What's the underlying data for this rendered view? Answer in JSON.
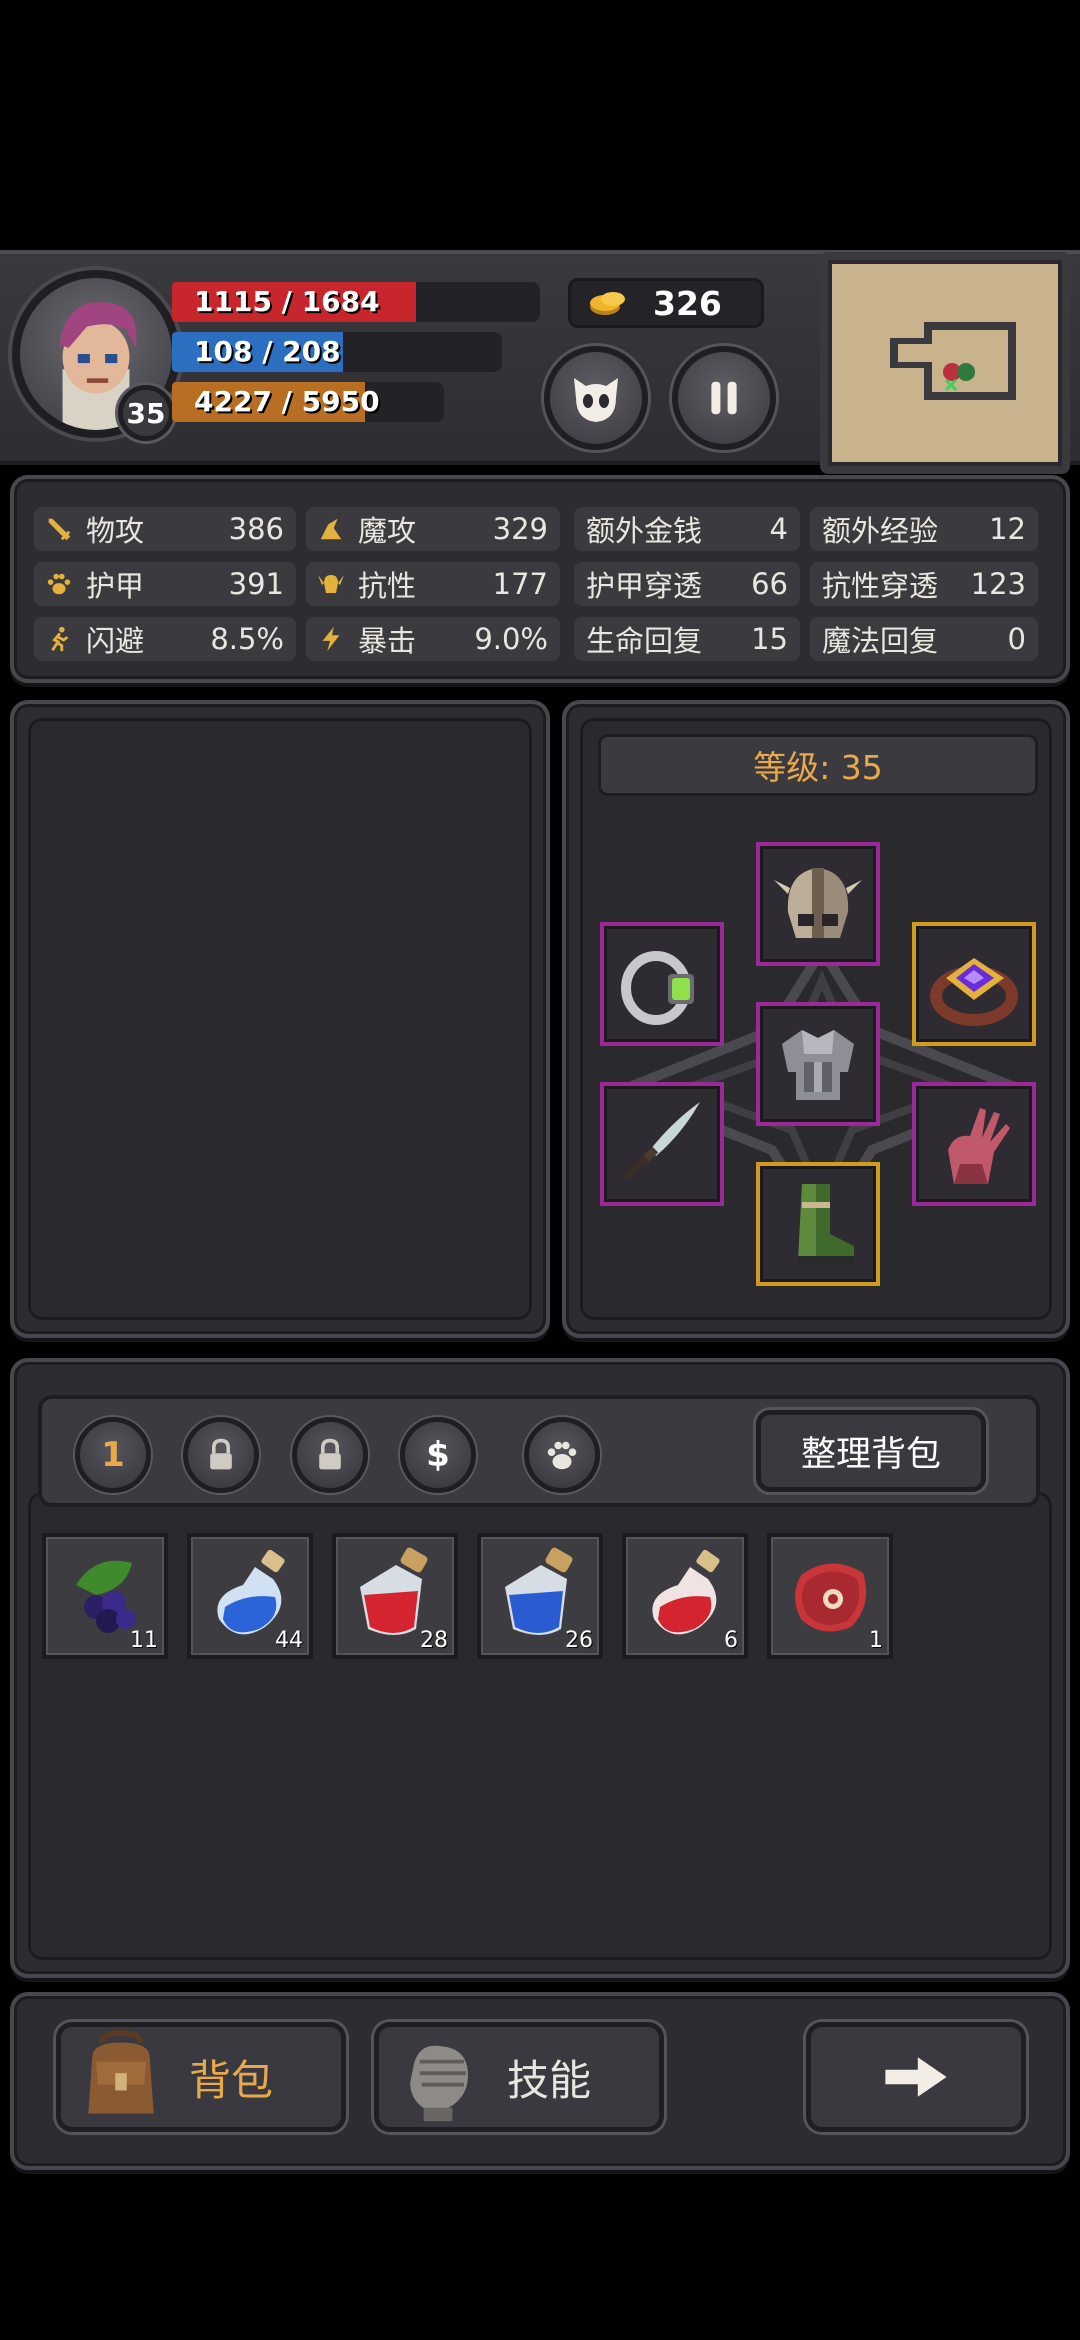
{
  "hud": {
    "hp": {
      "current": 1115,
      "max": 1684,
      "text": "1115 / 1684",
      "color": "#c6262c"
    },
    "mp": {
      "current": 108,
      "max": 208,
      "text": "108 / 208",
      "color": "#2c6fc1"
    },
    "xp": {
      "current": 4227,
      "max": 5950,
      "text": "4227 / 5950",
      "color": "#b86f23"
    },
    "level": "35",
    "gold": "326",
    "icons": {
      "portrait": "hero-portrait",
      "coin": "coin-icon",
      "character": "character-face-icon",
      "pause": "pause-icon",
      "minimap": "minimap"
    }
  },
  "stats": [
    {
      "label": "物攻",
      "value": "386",
      "icon": "sword-icon"
    },
    {
      "label": "魔攻",
      "value": "329",
      "icon": "wizard-hat-icon"
    },
    {
      "label": "额外金钱",
      "value": "4",
      "icon": ""
    },
    {
      "label": "额外经验",
      "value": "12",
      "icon": ""
    },
    {
      "label": "护甲",
      "value": "391",
      "icon": "paw-icon"
    },
    {
      "label": "抗性",
      "value": "177",
      "icon": "helmet-horns-icon"
    },
    {
      "label": "护甲穿透",
      "value": "66",
      "icon": ""
    },
    {
      "label": "抗性穿透",
      "value": "123",
      "icon": ""
    },
    {
      "label": "闪避",
      "value": "8.5%",
      "icon": "running-icon"
    },
    {
      "label": "暴击",
      "value": "9.0%",
      "icon": "lightning-icon"
    },
    {
      "label": "生命回复",
      "value": "15",
      "icon": ""
    },
    {
      "label": "魔法回复",
      "value": "0",
      "icon": ""
    }
  ],
  "equipment": {
    "level_label": "等级: 35",
    "slots": {
      "helmet": "helmet-icon",
      "ring_left": "silver-ring-icon",
      "ring_right": "gold-ring-icon",
      "chest": "chest-armor-icon",
      "weapon": "dagger-icon",
      "gloves": "gloves-icon",
      "boots": "boots-icon"
    }
  },
  "inventory": {
    "tabs": [
      {
        "label": "1",
        "icon": ""
      },
      {
        "label": "",
        "icon": "lock-icon"
      },
      {
        "label": "",
        "icon": "lock-icon"
      },
      {
        "label": "$",
        "icon": ""
      },
      {
        "label": "",
        "icon": "paw-icon"
      }
    ],
    "sort_label": "整理背包",
    "items": [
      {
        "icon": "berries-icon",
        "count": "11"
      },
      {
        "icon": "blue-potion-small-icon",
        "count": "44"
      },
      {
        "icon": "red-potion-large-icon",
        "count": "28"
      },
      {
        "icon": "blue-potion-large-icon",
        "count": "26"
      },
      {
        "icon": "red-potion-small-icon",
        "count": "6"
      },
      {
        "icon": "meat-icon",
        "count": "1"
      }
    ]
  },
  "nav": {
    "bag_label": "背包",
    "skills_label": "技能",
    "next_icon": "arrow-right-icon",
    "bag_color": "#e8a94a"
  }
}
